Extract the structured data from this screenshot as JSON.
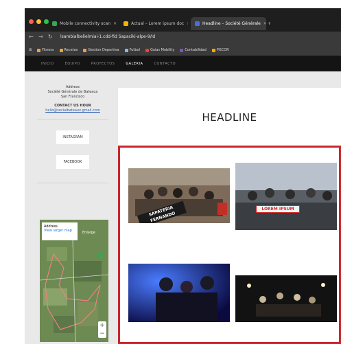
{
  "browser": {
    "tabs": [
      {
        "label": "Mobile connectivity scan",
        "active": false
      },
      {
        "label": "Actual – Lorem ipsum doc",
        "active": false
      },
      {
        "label": "Headline – Société Générale",
        "active": true
      }
    ],
    "url": "lsambialbelielmiai-1.cdd-fid Sapaciki-alpe-9/ld",
    "bookmarks": [
      "Fitness",
      "Recetas",
      "Gestion Deportiva",
      "Futbol",
      "Guias Mobility",
      "Contabilidad",
      "PGCOR"
    ]
  },
  "site": {
    "nav": [
      "INICIO",
      "EQUIPO",
      "PROYECTOS",
      "GALERIA",
      "CONTACTO"
    ],
    "current_nav_index": 3,
    "sidebar": {
      "lines": [
        "Address",
        "Société Générale de Bateaux",
        "San Francisco"
      ],
      "contact_heading": "CONTACT US HOUR",
      "email": "hello@socialbateaux.gmail.com",
      "buttons": [
        "INSTAGRAM",
        "FACEBOOK"
      ]
    },
    "map": {
      "card_title": "Address",
      "card_link": "View larger map",
      "enlarge": "Enlarge"
    },
    "headline": "HEADLINE",
    "photos": [
      {
        "banner": "SAPATERIA FERNANDO"
      },
      {
        "banner": "LOREM IPSUM"
      },
      {
        "banner": ""
      },
      {
        "banner": ""
      }
    ]
  }
}
